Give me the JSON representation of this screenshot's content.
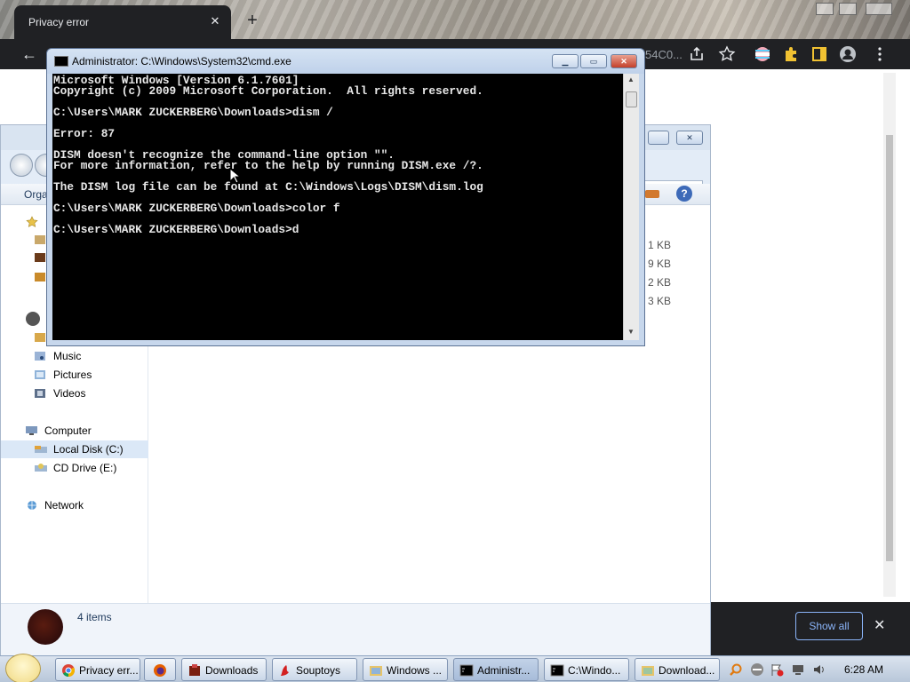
{
  "chrome": {
    "tab_title": "Privacy error",
    "tab_close": "✕",
    "new_tab": "+",
    "back": "←",
    "omnibox_tail": "54C0...",
    "show_all_label": "Show all",
    "downloadbar_close": "✕"
  },
  "cmd": {
    "title": "Administrator: C:\\Windows\\System32\\cmd.exe",
    "lines": [
      "Microsoft Windows [Version 6.1.7601]",
      "Copyright (c) 2009 Microsoft Corporation.  All rights reserved.",
      "",
      "C:\\Users\\MARK ZUCKERBERG\\Downloads>dism /",
      "",
      "Error: 87",
      "",
      "DISM doesn't recognize the command-line option \"\".",
      "For more information, refer to the help by running DISM.exe /?.",
      "",
      "The DISM log file can be found at C:\\Windows\\Logs\\DISM\\dism.log",
      "",
      "C:\\Users\\MARK ZUCKERBERG\\Downloads>color f",
      "",
      "C:\\Users\\MARK ZUCKERBERG\\Downloads>d"
    ]
  },
  "explorer": {
    "toolbar_organize": "Orga",
    "help": "?",
    "nav": {
      "music": "Music",
      "pictures": "Pictures",
      "videos": "Videos",
      "computer": "Computer",
      "local_disk": "Local Disk (C:)",
      "cd_drive": "CD Drive (E:)",
      "network": "Network"
    },
    "file_sizes": [
      "1 KB",
      "9 KB",
      "2 KB",
      "3 KB"
    ],
    "status_count": "4 items"
  },
  "taskbar": {
    "buttons": [
      {
        "label": "Privacy err...",
        "icon": "chrome-icon"
      },
      {
        "label": "",
        "icon": "firefox-icon"
      },
      {
        "label": "Downloads",
        "icon": "downloads-icon"
      },
      {
        "label": "Souptoys",
        "icon": "souptoys-icon"
      },
      {
        "label": "Windows ...",
        "icon": "windows-explorer-icon"
      },
      {
        "label": "Administr...",
        "icon": "cmd-icon"
      },
      {
        "label": "C:\\Windo...",
        "icon": "cmd-icon"
      },
      {
        "label": "Download...",
        "icon": "folder-icon"
      }
    ],
    "clock": "6:28 AM"
  }
}
